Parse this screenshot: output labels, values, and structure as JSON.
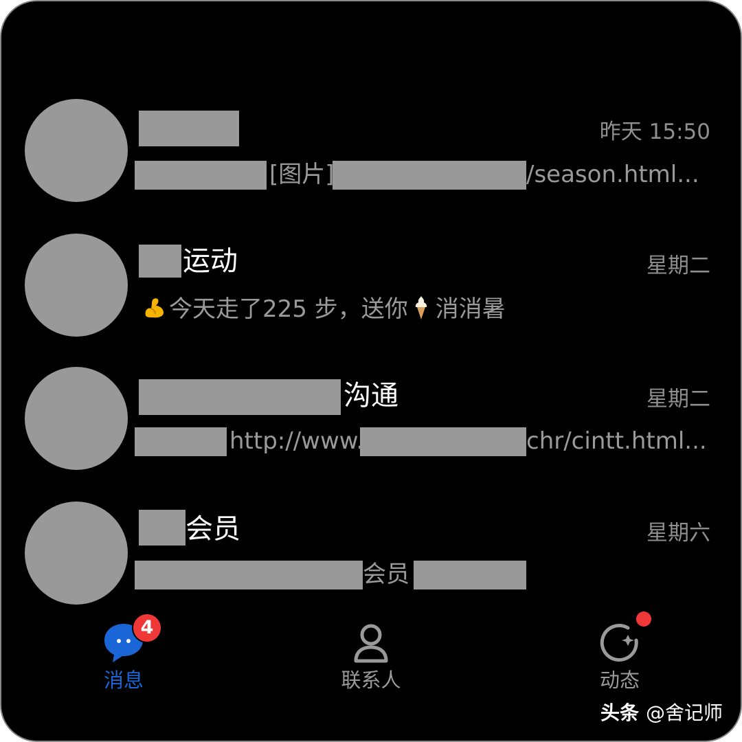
{
  "colors": {
    "background": "#000000",
    "accent": "#1a66d6",
    "badge": "#f03838",
    "redaction": "#999999",
    "muted": "#9a9a9a"
  },
  "conversations": [
    {
      "title_suffix": "",
      "time": "昨天 15:50",
      "preview_parts": [
        "[图片]",
        "/season.html..."
      ]
    },
    {
      "title_suffix": "运动",
      "time": "星期二",
      "preview_emoji_1": "flexed-biceps-icon",
      "preview_text_1": "今天走了225 步，送你",
      "preview_emoji_2": "soft-ice-cream-icon",
      "preview_text_2": "消消暑"
    },
    {
      "title_suffix": "沟通",
      "time": "星期二",
      "preview_parts": [
        "http://www.",
        "chr/cintt.html..."
      ]
    },
    {
      "title_suffix": "会员",
      "time": "星期六",
      "preview_parts": [
        "会员"
      ]
    }
  ],
  "tabs": [
    {
      "label": "消息",
      "icon": "chat-bubble-icon",
      "badge": "4",
      "active": true
    },
    {
      "label": "联系人",
      "icon": "contact-person-icon",
      "active": false
    },
    {
      "label": "动态",
      "icon": "moments-circle-icon",
      "has_dot": true,
      "active": false
    }
  ],
  "watermark": {
    "platform": "头条",
    "author": "@舍记师"
  }
}
